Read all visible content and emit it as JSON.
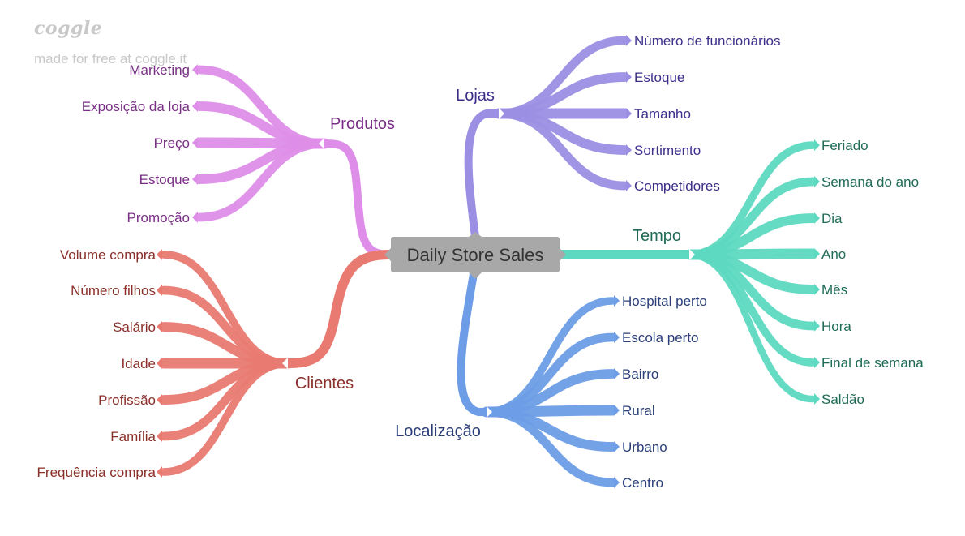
{
  "watermark": {
    "logo": "coggle",
    "text": "made for free at coggle.it"
  },
  "center": {
    "label": "Daily Store Sales"
  },
  "branches": [
    {
      "key": "lojas",
      "label": "Lojas",
      "color": "#9b8fe3",
      "text_color": "#3b2f8a",
      "items": [
        "Número de funcionários",
        "Estoque",
        "Tamanho",
        "Sortimento",
        "Competidores"
      ]
    },
    {
      "key": "tempo",
      "label": "Tempo",
      "color": "#5dd9c1",
      "text_color": "#1f6b57",
      "items": [
        "Feriado",
        "Semana do ano",
        "Dia",
        "Ano",
        "Mês",
        "Hora",
        "Final de semana",
        "Saldão"
      ]
    },
    {
      "key": "localizacao",
      "label": "Localização",
      "color": "#6d9de6",
      "text_color": "#2b3f7a",
      "items": [
        "Hospital perto",
        "Escola perto",
        "Bairro",
        "Rural",
        "Urbano",
        "Centro"
      ]
    },
    {
      "key": "produtos",
      "label": "Produtos",
      "color": "#de8ee8",
      "text_color": "#7a2f86",
      "items": [
        "Marketing",
        "Exposição da loja",
        "Preço",
        "Estoque",
        "Promoção"
      ]
    },
    {
      "key": "clientes",
      "label": "Clientes",
      "color": "#e97a72",
      "text_color": "#8a2f29",
      "items": [
        "Volume compra",
        "Número filhos",
        "Salário",
        "Idade",
        "Profissão",
        "Família",
        "Frequência compra"
      ]
    }
  ]
}
